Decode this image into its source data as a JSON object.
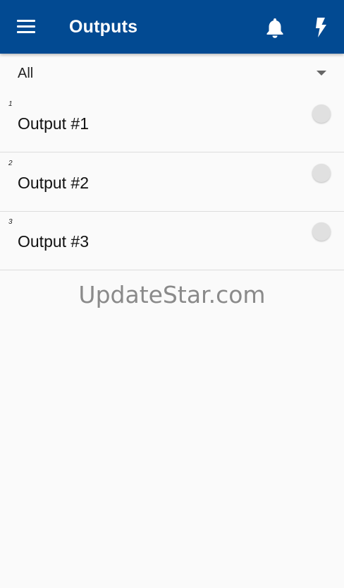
{
  "appbar": {
    "title": "Outputs",
    "menu_icon": "menu-icon",
    "notification_icon": "bell-icon",
    "action_icon": "flash-icon",
    "background_color": "#024a92"
  },
  "filter": {
    "selected": "All"
  },
  "outputs": [
    {
      "index": "1",
      "label": "Output #1",
      "state": "off"
    },
    {
      "index": "2",
      "label": "Output #2",
      "state": "off"
    },
    {
      "index": "3",
      "label": "Output #3",
      "state": "off"
    }
  ],
  "watermark": "UpdateStar.com"
}
